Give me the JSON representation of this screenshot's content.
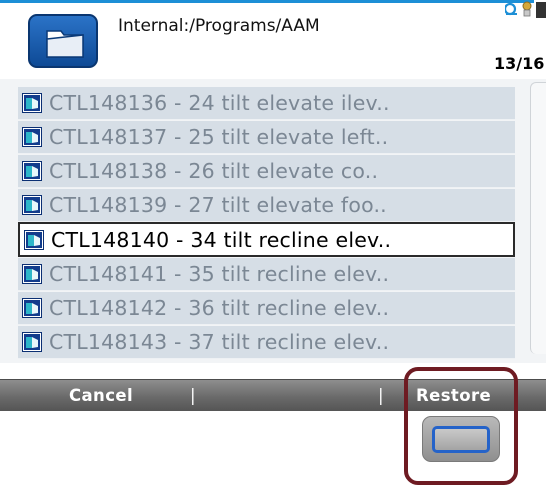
{
  "header": {
    "path": "Internal:/Programs/AAM",
    "count": "13/16",
    "folder_icon": "folder-icon",
    "status_icon": "status-icon"
  },
  "list": {
    "items": [
      {
        "label": "CTL148136 - 24 tilt elevate ilev..",
        "selected": false
      },
      {
        "label": "CTL148137 - 25 tilt elevate left..",
        "selected": false
      },
      {
        "label": "CTL148138 - 26 tilt elevate co..",
        "selected": false
      },
      {
        "label": "CTL148139 - 27 tilt elevate foo..",
        "selected": false
      },
      {
        "label": "CTL148140 - 34 tilt recline elev..",
        "selected": true
      },
      {
        "label": "CTL148141 - 35 tilt recline elev..",
        "selected": false
      },
      {
        "label": "CTL148142 - 36 tilt recline elev..",
        "selected": false
      },
      {
        "label": "CTL148143 - 37 tilt recline elev..",
        "selected": false
      }
    ],
    "item_icon": "program-file-icon"
  },
  "softkeys": {
    "cancel": "Cancel",
    "blank": "",
    "restore": "Restore",
    "separator": "|"
  },
  "hardware": {
    "key_icon": "hardware-softkey-button"
  },
  "colors": {
    "accent": "#1d8fd6",
    "folder_blue": "#0e4a96",
    "row_bg": "#d6dee6",
    "row_text": "#7b8794",
    "highlight_box": "#6e1b22",
    "hw_key_outline": "#2563c9"
  }
}
